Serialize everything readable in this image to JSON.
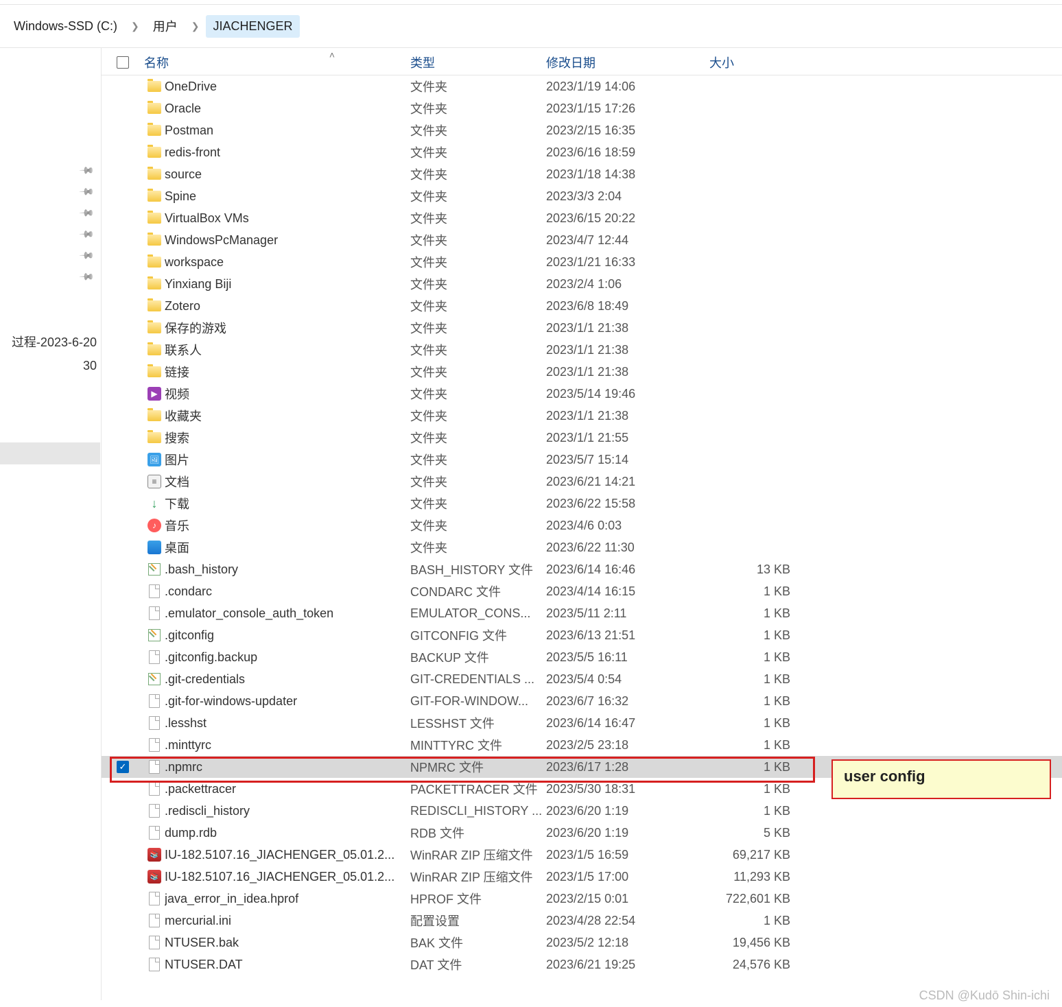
{
  "breadcrumbs": [
    "Windows-SSD (C:)",
    "用户",
    "JIACHENGER"
  ],
  "nav": {
    "pin_count": 6,
    "text_line1": "过程-2023-6-20",
    "text_line2": "30"
  },
  "columns": {
    "name": "名称",
    "type": "类型",
    "date": "修改日期",
    "size": "大小"
  },
  "annotation": "user  config",
  "watermark": "CSDN @Kudō Shin-ichi",
  "rows": [
    {
      "icon": "folder",
      "name": "OneDrive",
      "type": "文件夹",
      "date": "2023/1/19 14:06",
      "size": ""
    },
    {
      "icon": "folder",
      "name": "Oracle",
      "type": "文件夹",
      "date": "2023/1/15 17:26",
      "size": ""
    },
    {
      "icon": "folder",
      "name": "Postman",
      "type": "文件夹",
      "date": "2023/2/15 16:35",
      "size": ""
    },
    {
      "icon": "folder",
      "name": "redis-front",
      "type": "文件夹",
      "date": "2023/6/16 18:59",
      "size": ""
    },
    {
      "icon": "folder",
      "name": "source",
      "type": "文件夹",
      "date": "2023/1/18 14:38",
      "size": ""
    },
    {
      "icon": "folder",
      "name": "Spine",
      "type": "文件夹",
      "date": "2023/3/3 2:04",
      "size": ""
    },
    {
      "icon": "folder",
      "name": "VirtualBox VMs",
      "type": "文件夹",
      "date": "2023/6/15 20:22",
      "size": ""
    },
    {
      "icon": "folder",
      "name": "WindowsPcManager",
      "type": "文件夹",
      "date": "2023/4/7 12:44",
      "size": ""
    },
    {
      "icon": "folder",
      "name": "workspace",
      "type": "文件夹",
      "date": "2023/1/21 16:33",
      "size": ""
    },
    {
      "icon": "folder",
      "name": "Yinxiang Biji",
      "type": "文件夹",
      "date": "2023/2/4 1:06",
      "size": ""
    },
    {
      "icon": "folder",
      "name": "Zotero",
      "type": "文件夹",
      "date": "2023/6/8 18:49",
      "size": ""
    },
    {
      "icon": "folder",
      "name": "保存的游戏",
      "type": "文件夹",
      "date": "2023/1/1 21:38",
      "size": ""
    },
    {
      "icon": "folder",
      "name": "联系人",
      "type": "文件夹",
      "date": "2023/1/1 21:38",
      "size": ""
    },
    {
      "icon": "folder",
      "name": "链接",
      "type": "文件夹",
      "date": "2023/1/1 21:38",
      "size": ""
    },
    {
      "icon": "video",
      "name": "视频",
      "type": "文件夹",
      "date": "2023/5/14 19:46",
      "size": ""
    },
    {
      "icon": "folder",
      "name": "收藏夹",
      "type": "文件夹",
      "date": "2023/1/1 21:38",
      "size": ""
    },
    {
      "icon": "folder",
      "name": "搜索",
      "type": "文件夹",
      "date": "2023/1/1 21:55",
      "size": ""
    },
    {
      "icon": "pic",
      "name": "图片",
      "type": "文件夹",
      "date": "2023/5/7 15:14",
      "size": ""
    },
    {
      "icon": "doc",
      "name": "文档",
      "type": "文件夹",
      "date": "2023/6/21 14:21",
      "size": ""
    },
    {
      "icon": "dl",
      "name": "下载",
      "type": "文件夹",
      "date": "2023/6/22 15:58",
      "size": ""
    },
    {
      "icon": "music",
      "name": "音乐",
      "type": "文件夹",
      "date": "2023/4/6 0:03",
      "size": ""
    },
    {
      "icon": "desktop",
      "name": "桌面",
      "type": "文件夹",
      "date": "2023/6/22 11:30",
      "size": ""
    },
    {
      "icon": "edit",
      "name": ".bash_history",
      "type": "BASH_HISTORY 文件",
      "date": "2023/6/14 16:46",
      "size": "13 KB"
    },
    {
      "icon": "file",
      "name": ".condarc",
      "type": "CONDARC 文件",
      "date": "2023/4/14 16:15",
      "size": "1 KB"
    },
    {
      "icon": "file",
      "name": ".emulator_console_auth_token",
      "type": "EMULATOR_CONS...",
      "date": "2023/5/11 2:11",
      "size": "1 KB"
    },
    {
      "icon": "edit",
      "name": ".gitconfig",
      "type": "GITCONFIG 文件",
      "date": "2023/6/13 21:51",
      "size": "1 KB"
    },
    {
      "icon": "file",
      "name": ".gitconfig.backup",
      "type": "BACKUP 文件",
      "date": "2023/5/5 16:11",
      "size": "1 KB"
    },
    {
      "icon": "edit",
      "name": ".git-credentials",
      "type": "GIT-CREDENTIALS ...",
      "date": "2023/5/4 0:54",
      "size": "1 KB"
    },
    {
      "icon": "file",
      "name": ".git-for-windows-updater",
      "type": "GIT-FOR-WINDOW...",
      "date": "2023/6/7 16:32",
      "size": "1 KB"
    },
    {
      "icon": "file",
      "name": ".lesshst",
      "type": "LESSHST 文件",
      "date": "2023/6/14 16:47",
      "size": "1 KB"
    },
    {
      "icon": "file",
      "name": ".minttyrc",
      "type": "MINTTYRC 文件",
      "date": "2023/2/5 23:18",
      "size": "1 KB"
    },
    {
      "icon": "file",
      "name": ".npmrc",
      "type": "NPMRC 文件",
      "date": "2023/6/17 1:28",
      "size": "1 KB",
      "selected": true
    },
    {
      "icon": "file",
      "name": ".packettracer",
      "type": "PACKETTRACER 文件",
      "date": "2023/5/30 18:31",
      "size": "1 KB"
    },
    {
      "icon": "file",
      "name": ".rediscli_history",
      "type": "REDISCLI_HISTORY ...",
      "date": "2023/6/20 1:19",
      "size": "1 KB"
    },
    {
      "icon": "file",
      "name": "dump.rdb",
      "type": "RDB 文件",
      "date": "2023/6/20 1:19",
      "size": "5 KB"
    },
    {
      "icon": "rar",
      "name": "IU-182.5107.16_JIACHENGER_05.01.2...",
      "type": "WinRAR ZIP 压缩文件",
      "date": "2023/1/5 16:59",
      "size": "69,217 KB"
    },
    {
      "icon": "rar",
      "name": "IU-182.5107.16_JIACHENGER_05.01.2...",
      "type": "WinRAR ZIP 压缩文件",
      "date": "2023/1/5 17:00",
      "size": "11,293 KB"
    },
    {
      "icon": "file",
      "name": "java_error_in_idea.hprof",
      "type": "HPROF 文件",
      "date": "2023/2/15 0:01",
      "size": "722,601 KB"
    },
    {
      "icon": "file",
      "name": "mercurial.ini",
      "type": "配置设置",
      "date": "2023/4/28 22:54",
      "size": "1 KB"
    },
    {
      "icon": "file",
      "name": "NTUSER.bak",
      "type": "BAK 文件",
      "date": "2023/5/2 12:18",
      "size": "19,456 KB"
    },
    {
      "icon": "file",
      "name": "NTUSER.DAT",
      "type": "DAT 文件",
      "date": "2023/6/21 19:25",
      "size": "24,576 KB"
    }
  ]
}
